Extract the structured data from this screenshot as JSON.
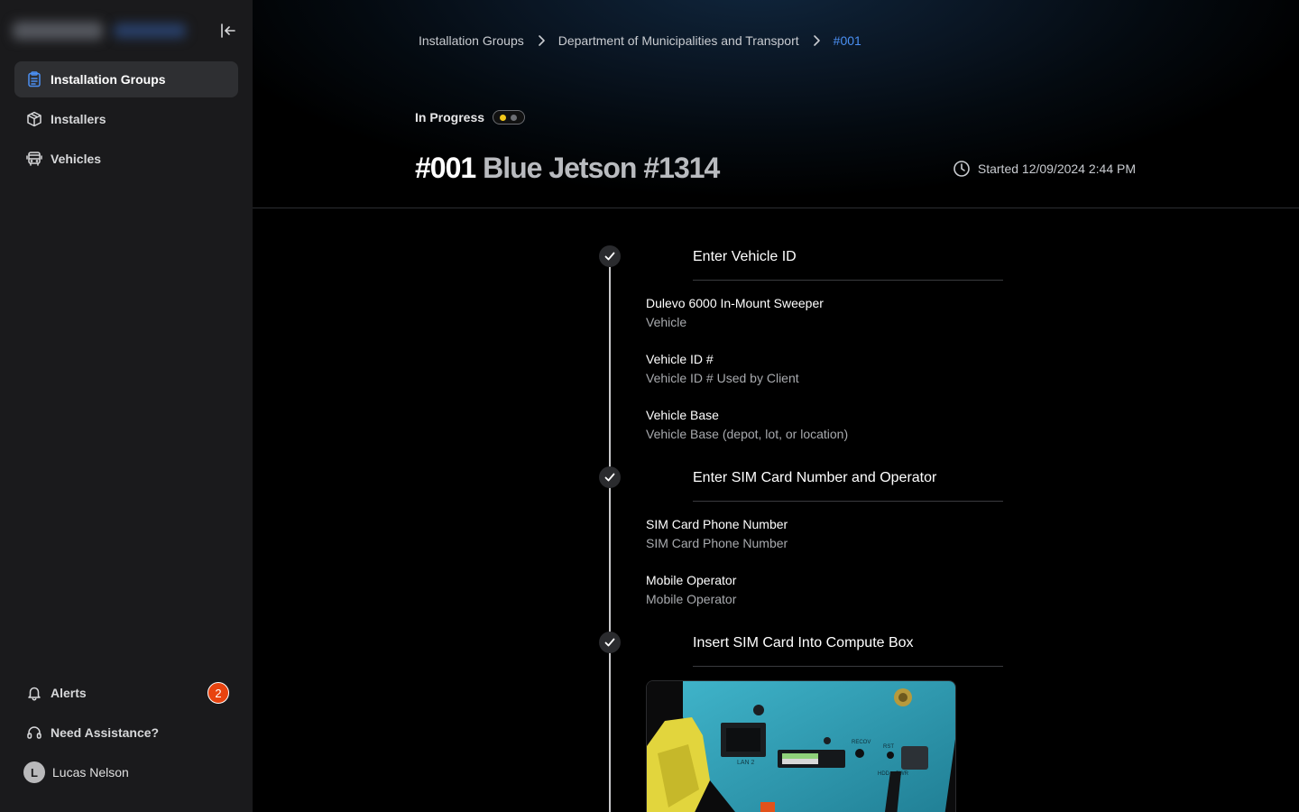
{
  "sidebar": {
    "nav": [
      {
        "label": "Installation Groups",
        "icon": "clipboard-icon",
        "active": true
      },
      {
        "label": "Installers",
        "icon": "box-icon",
        "active": false
      },
      {
        "label": "Vehicles",
        "icon": "bus-icon",
        "active": false
      }
    ],
    "alerts": {
      "label": "Alerts",
      "count": "2"
    },
    "assistance": {
      "label": "Need Assistance?"
    },
    "user": {
      "name": "Lucas Nelson",
      "initial": "L"
    }
  },
  "breadcrumb": {
    "items": [
      "Installation Groups",
      "Department of Municipalities and Transport"
    ],
    "current": "#001"
  },
  "status": {
    "label": "In Progress",
    "color": "#f3c81a"
  },
  "page": {
    "number": "#001",
    "name": "Blue Jetson #1314",
    "started": "Started 12/09/2024 2:44 PM"
  },
  "steps": [
    {
      "title": "Enter Vehicle ID",
      "fields": [
        {
          "label": "Dulevo 6000 In-Mount Sweeper",
          "value": "Vehicle"
        },
        {
          "label": "Vehicle ID #",
          "value": "Vehicle ID # Used by Client"
        },
        {
          "label": "Vehicle Base",
          "value": "Vehicle Base (depot, lot, or location)"
        }
      ]
    },
    {
      "title": "Enter SIM Card Number and Operator",
      "fields": [
        {
          "label": "SIM Card Phone Number",
          "value": "SIM Card Phone Number"
        },
        {
          "label": "Mobile Operator",
          "value": "Mobile Operator"
        }
      ]
    },
    {
      "title": "Insert SIM Card Into Compute Box",
      "photo_labels": {
        "lan": "LAN 2",
        "recov": "RECOV",
        "rst": "RST",
        "hdd": "HDD",
        "pwr": "PWR"
      }
    }
  ],
  "colors": {
    "accent": "#4b8ff2",
    "badge": "#e8430f",
    "sidebar_bg": "#1a1a1c",
    "active_bg": "#2e2f32"
  }
}
